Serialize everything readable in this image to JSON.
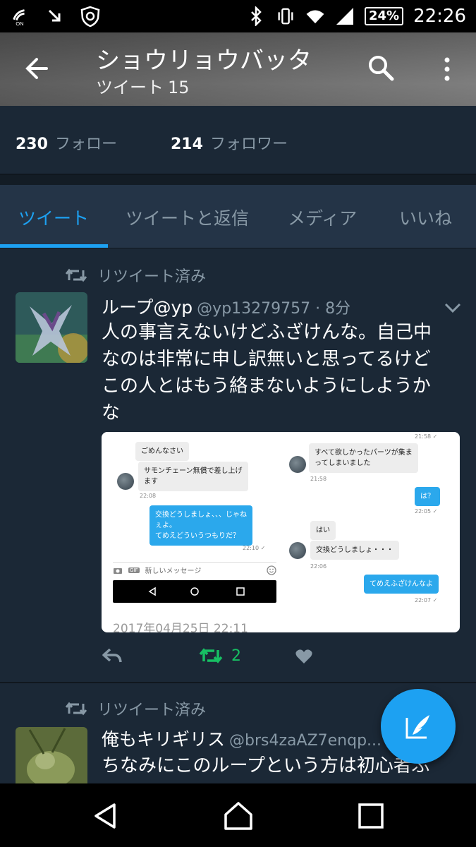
{
  "status_bar": {
    "nfc_label": "ON",
    "battery": "24%",
    "time": "22:26"
  },
  "header": {
    "title": "ショウリョウバッタ",
    "subtitle_label": "ツイート",
    "tweet_count": "15"
  },
  "profile_stats": {
    "following_count": "230",
    "following_label": "フォロー",
    "followers_count": "214",
    "followers_label": "フォロワー"
  },
  "tabs": [
    {
      "label": "ツイート",
      "active": true
    },
    {
      "label": "ツイートと返信",
      "active": false
    },
    {
      "label": "メディア",
      "active": false
    },
    {
      "label": "いいね",
      "active": false
    }
  ],
  "tweets": [
    {
      "retweet_label": "リツイート済み",
      "name": "ループ@yp",
      "handle": "@yp13279757 · 8分",
      "text_lines": [
        "人の事言えないけどふざけんな。自己中",
        "なのは非常に申し訳無いと思ってるけど",
        "この人とはもう絡まないようにしようか",
        "な"
      ],
      "media": {
        "left": {
          "bubble1": "ごめんなさい",
          "bubble2_l1": "サモンチェーン無償で差し上げ",
          "bubble2_l2": "ます",
          "time1": "22:08",
          "bubble3_l1": "交換どうしましょ、、、じゃね",
          "bubble3_l2": "ぇよ。",
          "bubble3_l3": "てめえどういうつもりだ？",
          "time2": "22:10 ✓",
          "input_placeholder": "新しいメッセージ",
          "gif_label": "GIF"
        },
        "right": {
          "time_top": "21:58 ✓",
          "bubble1_l1": "すべて欲しかったパーツが集ま",
          "bubble1_l2": "ってしまいました",
          "time1": "21:58",
          "bubble2": "は？",
          "time2": "22:05 ✓",
          "bubble3": "はい",
          "bubble4": "交換どうしましょ・・・",
          "time3": "22:06",
          "bubble5": "てめえふざけんなよ",
          "time4": "22:07 ✓"
        },
        "date_stamp": "2017年04月25日 22:11"
      },
      "retweet_count": "2"
    },
    {
      "retweet_label": "リツイート済み",
      "name": "俺もキリギリス",
      "handle": "@brs4zaAZ7enqp...",
      "text_lines": [
        "ちなみにこのループという方は初心者ぶ"
      ]
    }
  ],
  "colors": {
    "accent": "#1da1f2",
    "retweet_green": "#17bf63",
    "background": "#1b2836",
    "secondary_text": "#8899a6"
  }
}
